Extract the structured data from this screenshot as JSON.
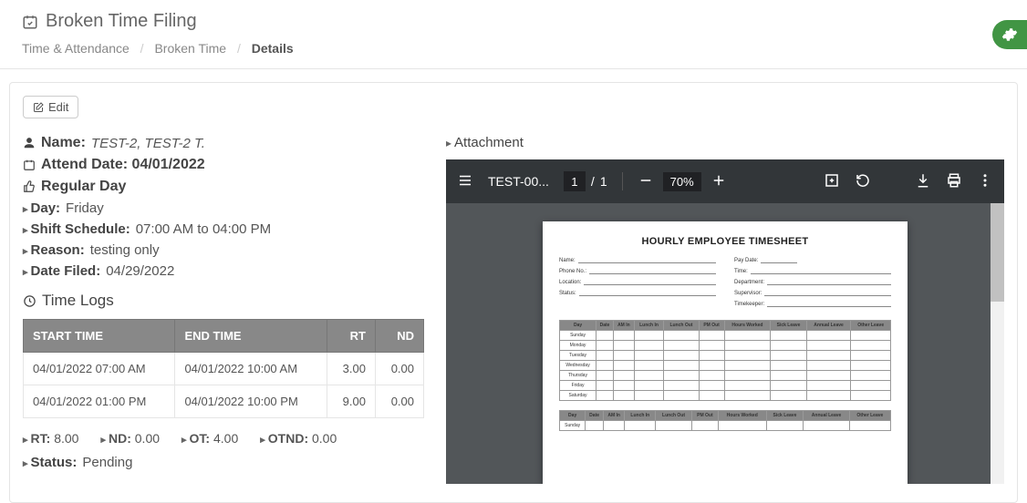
{
  "page": {
    "title": "Broken Time Filing"
  },
  "breadcrumb": {
    "part1": "Time & Attendance",
    "part2": "Broken Time",
    "current": "Details"
  },
  "buttons": {
    "edit": "Edit"
  },
  "info": {
    "name_label": "Name:",
    "name_value": "TEST-2, TEST-2 T.",
    "attend_label": "Attend Date: 04/01/2022",
    "regular_label": "Regular Day",
    "day_label": "Day:",
    "day_value": "Friday",
    "shift_label": "Shift Schedule:",
    "shift_value": "07:00 AM to 04:00 PM",
    "reason_label": "Reason:",
    "reason_value": "testing only",
    "filed_label": "Date Filed:",
    "filed_value": "04/29/2022"
  },
  "timelogs": {
    "title": "Time Logs",
    "cols": {
      "start": "START TIME",
      "end": "END TIME",
      "rt": "RT",
      "nd": "ND"
    },
    "rows": [
      {
        "start": "04/01/2022 07:00 AM",
        "end": "04/01/2022 10:00 AM",
        "rt": "3.00",
        "nd": "0.00"
      },
      {
        "start": "04/01/2022 01:00 PM",
        "end": "04/01/2022 10:00 PM",
        "rt": "9.00",
        "nd": "0.00"
      }
    ]
  },
  "totals": {
    "rt_label": "RT:",
    "rt_value": "8.00",
    "nd_label": "ND:",
    "nd_value": "0.00",
    "ot_label": "OT:",
    "ot_value": "4.00",
    "otnd_label": "OTND:",
    "otnd_value": "0.00"
  },
  "status": {
    "label": "Status:",
    "value": "Pending"
  },
  "attachment": {
    "title": "Attachment"
  },
  "pdf": {
    "filename": "TEST-00...",
    "page_cur": "1",
    "page_sep": "/",
    "page_total": "1",
    "zoom_pct": "70%",
    "sheet_title": "HOURLY EMPLOYEE TIMESHEET",
    "fields_left": [
      "Name:",
      "Phone No.:",
      "Location:",
      "Status:"
    ],
    "fields_right": [
      "Pay Date:",
      "Time:",
      "Department:",
      "Supervisor:",
      "Timekeeper:"
    ],
    "sheet_cols": [
      "Day",
      "Date",
      "AM In",
      "Lunch In",
      "Lunch Out",
      "PM Out",
      "Hours Worked",
      "Sick Leave",
      "Annual Leave",
      "Other Leave"
    ],
    "sheet_days": [
      "Sunday",
      "Monday",
      "Tuesday",
      "Wednesday",
      "Thursday",
      "Friday",
      "Saturday"
    ]
  }
}
